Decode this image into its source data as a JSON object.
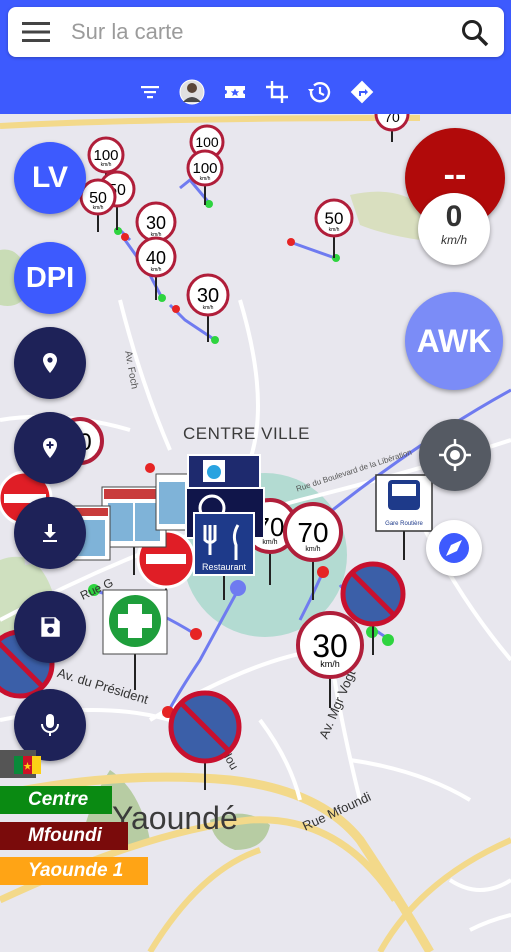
{
  "search": {
    "placeholder": "Sur la carte"
  },
  "toolbar": {
    "icons": [
      "filter-icon",
      "avatar-icon",
      "ticket-icon",
      "crop-icon",
      "history-icon",
      "directions-icon"
    ]
  },
  "fabs": {
    "lv": "LV",
    "dpi": "DPI",
    "awk": "AWK"
  },
  "speed": {
    "limit_display": "--",
    "current": "0",
    "unit": "km/h"
  },
  "map": {
    "district_label": "CENTRE VILLE",
    "city_label": "Yaoundé",
    "streets": [
      "Av. du Président",
      "Av. Mgr Vogt",
      "Rue Mfoundi",
      "Rue G",
      "Av. Foch",
      "Rue du Boulevard de la Libération",
      "ndou"
    ],
    "speed_signs": [
      "100",
      "100",
      "50",
      "50",
      "30",
      "40",
      "30",
      "50",
      "70",
      "30",
      "50",
      "100",
      "70"
    ],
    "sign_unit": "km/h",
    "bus_station_label": "Gare Routière",
    "restaurant_label": "Restaurant",
    "supermarket_label": "SUPERMARKET"
  },
  "location": {
    "region": "Centre",
    "department": "Mfoundi",
    "commune": "Yaounde 1"
  },
  "colors": {
    "accent": "#3d5afe",
    "navy": "#1e2258",
    "red": "#b10a0a",
    "awk": "#7b8cf7",
    "centre": "#0a8a12",
    "mfoundi": "#7a0b0b",
    "yaounde": "#ffa415"
  }
}
